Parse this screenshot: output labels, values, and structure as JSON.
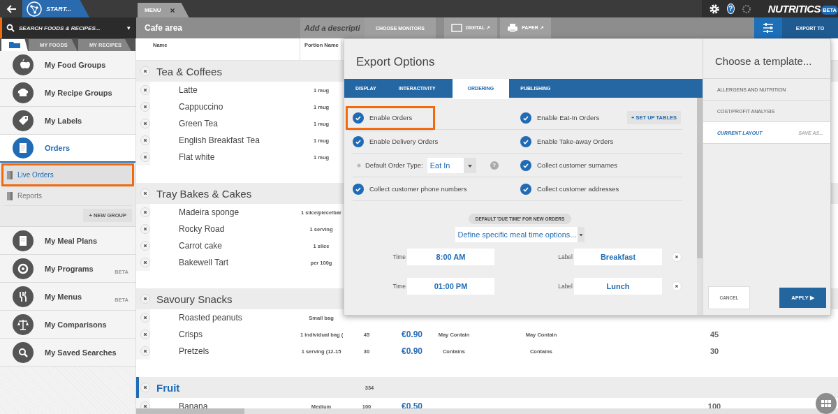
{
  "top_bar": {
    "start_tab": "START...",
    "doc_tab": {
      "label": "MENU",
      "selected": true
    },
    "help": "?",
    "brand": {
      "name": "NUTRITICS",
      "badge": "BETA"
    }
  },
  "toolbar": {
    "search": {
      "placeholder": "SEARCH FOODS & RECIPES...",
      "caret": "▾"
    },
    "menu_title": "Cafe area",
    "description": {
      "value": "Add a descripti"
    },
    "buttons": [
      {
        "label": "CHOOSE MONITORS",
        "kind": "plain"
      },
      {
        "label": "DIGITAL ↗",
        "kind": "monitor"
      },
      {
        "label": "PAPER ↗",
        "kind": "printer"
      }
    ],
    "export_button": "EXPORT TO"
  },
  "sidebar": {
    "tabs": [
      {
        "kind": "folder",
        "selected": true
      },
      {
        "kind": "text",
        "label": "MY FOODS",
        "selected": false
      },
      {
        "kind": "text",
        "label": "MY RECIPES",
        "selected": false
      }
    ],
    "items": [
      {
        "label": "My Food Groups",
        "selected": false
      },
      {
        "label": "My Recipe Groups",
        "selected": false
      },
      {
        "label": "My Labels",
        "selected": false
      },
      {
        "label": "Orders",
        "selected": true,
        "children": [
          {
            "label": "Live Orders",
            "selected": true,
            "highlighted": true
          },
          {
            "label": "Reports",
            "selected": false,
            "highlighted": false
          }
        ],
        "new_group": "+ NEW GROUP"
      },
      {
        "label": "My Meal Plans",
        "selected": false
      },
      {
        "label": "My Programs",
        "selected": false,
        "badge": "BETA"
      },
      {
        "label": "My Menus",
        "selected": false,
        "badge": "BETA"
      },
      {
        "label": "My Comparisons",
        "selected": false
      },
      {
        "label": "My Saved Searches",
        "selected": false
      }
    ]
  },
  "table": {
    "columns": [
      "Name",
      "Portion Name"
    ],
    "groups": [
      {
        "title": "Tea & Coffees",
        "selected": false,
        "rows": [
          {
            "name": "Latte",
            "portion": "1 mug"
          },
          {
            "name": "Cappuccino",
            "portion": "1 mug"
          },
          {
            "name": "Green Tea",
            "portion": "1 mug"
          },
          {
            "name": "English Breakfast Tea",
            "portion": "1 mug"
          },
          {
            "name": "Flat white",
            "portion": "1 mug"
          }
        ]
      },
      {
        "title": "Tray Bakes & Cakes",
        "selected": false,
        "rows": [
          {
            "name": "Madeira sponge",
            "portion": "1 slice/piece/bar"
          },
          {
            "name": "Rocky Road",
            "portion": "1 serving"
          },
          {
            "name": "Carrot cake",
            "portion": "1 slice"
          },
          {
            "name": "Bakewell Tart",
            "portion": "per 100g"
          }
        ]
      },
      {
        "title": "Savoury Snacks",
        "selected": false,
        "rows": [
          {
            "name": "Roasted peanuts",
            "portion": "Small bag"
          },
          {
            "name": "Crisps",
            "portion": "1 individual bag (",
            "column_3": "45",
            "column_4": "€0.90",
            "column_5": "May Contain",
            "column_6": "May Contain",
            "column_8": "45"
          },
          {
            "name": "Pretzels",
            "portion": "1 serving (12-15",
            "column_3": "30",
            "column_4": "€0.90",
            "column_5": "Contains",
            "column_6": "Contains",
            "column_8": "30"
          }
        ]
      },
      {
        "title": "Fruit",
        "selected": true,
        "column_3": "334",
        "rows": [
          {
            "name": "Banana",
            "portion": "Medium",
            "column_3": "100",
            "column_4": "€0.50",
            "column_8": "100"
          }
        ]
      }
    ]
  },
  "export_dialog": {
    "title": "Export Options",
    "tabs": [
      {
        "label": "DISPLAY",
        "selected": false
      },
      {
        "label": "INTERACTIVITY",
        "selected": false
      },
      {
        "label": "ORDERING",
        "selected": true
      },
      {
        "label": "PUBLISHING",
        "selected": false
      }
    ],
    "options": [
      {
        "kind": "check",
        "label": "Enable Orders",
        "checked": true,
        "highlighted": true
      },
      {
        "kind": "check",
        "label": "Enable Eat-In Orders",
        "checked": true,
        "highlighted": false,
        "action": "+ SET UP TABLES"
      },
      {
        "kind": "check",
        "label": "Enable Delivery Orders",
        "checked": true,
        "highlighted": false
      },
      {
        "kind": "check",
        "label": "Enable Take-away Orders",
        "checked": true,
        "highlighted": false
      },
      {
        "kind": "select",
        "label": "Default Order Type:",
        "value": "Eat In",
        "help": "?"
      },
      {
        "kind": "check",
        "label": "Collect customer surnames",
        "checked": true,
        "highlighted": false
      },
      {
        "kind": "check",
        "label": "Collect customer phone numbers",
        "checked": true,
        "highlighted": false
      },
      {
        "kind": "check",
        "label": "Collect customer addresses",
        "checked": true,
        "highlighted": false
      }
    ],
    "due_time": {
      "heading": "DEFAULT 'DUE TIME' FOR NEW ORDERS",
      "mode": "Define specific meal time options...",
      "meal_times": [
        {
          "time_caption": "Time",
          "time": "8:00 AM",
          "label_caption": "Label",
          "label": "Breakfast"
        },
        {
          "time_caption": "Time",
          "time": "01:00 PM",
          "label_caption": "Label",
          "label": "Lunch"
        }
      ]
    }
  },
  "template_panel": {
    "title": "Choose a template...",
    "templates": [
      {
        "label": "ALLERGENS AND NUTRITION",
        "selected": false
      },
      {
        "label": "COST/PROFIT ANALYSIS",
        "selected": false
      },
      {
        "label": "CURRENT LAYOUT",
        "selected": true,
        "action": "SAVE AS..."
      }
    ],
    "buttons": [
      {
        "label": "CANCEL",
        "kind": "secondary"
      },
      {
        "label": "APPLY ▶",
        "kind": "primary"
      }
    ]
  }
}
